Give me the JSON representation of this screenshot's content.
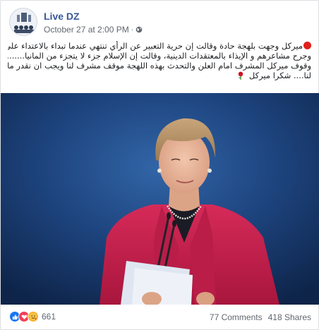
{
  "post": {
    "page_name": "Live DZ",
    "timestamp": "October 27 at 2:00 PM",
    "separator": "·",
    "privacy_icon": "globe-icon",
    "avatar_icon": "page-logo-icon",
    "text_lines": [
      "ميركل وجهت بلهجة حادة وقالت إن حرية التعبير عن الرأي تنتهي عندما تبداء بالاعتداء على الآخرين",
      "وجرح مشاعرهم و الإيذاء بالمعتقدات الدينية، وقالت إن الإسلام جزء لا يتجزء من المانيا.......",
      "وقوف ميركل المشرف امام العلن والتحدث بهذه اللهجة موقف مشرف لنا ويجب ان نقدر ما فعلته هذه المراه",
      "لنا.... شكرا ميركل"
    ],
    "photo_description_icon": "post-photo"
  },
  "footer": {
    "reaction_icons": [
      "like-icon",
      "love-icon",
      "care-icon"
    ],
    "reaction_count": "661",
    "comments": "77 Comments",
    "shares": "418 Shares"
  },
  "colors": {
    "page_name": "#385898",
    "meta": "#606770",
    "like": "#1877f2",
    "love": "#f33e58",
    "care": "#f7b125",
    "photo_bg": "#1b3f77",
    "jacket": "#c8234f"
  }
}
